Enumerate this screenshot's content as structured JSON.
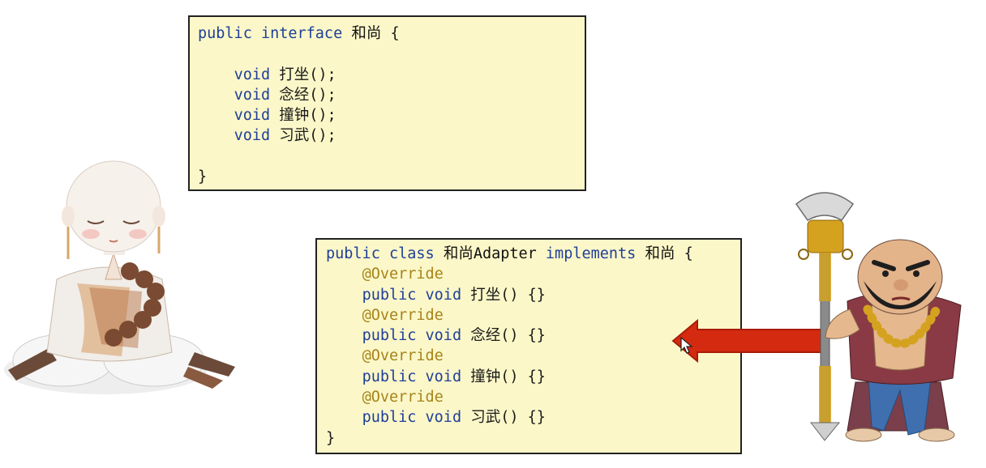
{
  "interface_code": {
    "header": {
      "kw_public": "public",
      "kw_interface": "interface",
      "name": "和尚",
      "brace": "{"
    },
    "methods": [
      {
        "kw": "void",
        "name": "打坐",
        "tail": "();"
      },
      {
        "kw": "void",
        "name": "念经",
        "tail": "();"
      },
      {
        "kw": "void",
        "name": "撞钟",
        "tail": "();"
      },
      {
        "kw": "void",
        "name": "习武",
        "tail": "();"
      }
    ],
    "close": "}"
  },
  "adapter_code": {
    "header": {
      "kw_public": "public",
      "kw_class": "class",
      "name": "和尚Adapter",
      "kw_implements": "implements",
      "iface": "和尚",
      "brace": "{"
    },
    "methods": [
      {
        "annotation": "@Override",
        "kw": "public void",
        "name": "打坐",
        "tail": "() {}"
      },
      {
        "annotation": "@Override",
        "kw": "public void",
        "name": "念经",
        "tail": "() {}"
      },
      {
        "annotation": "@Override",
        "kw": "public void",
        "name": "撞钟",
        "tail": "() {}"
      },
      {
        "annotation": "@Override",
        "kw": "public void",
        "name": "习武",
        "tail": "() {}"
      }
    ],
    "close": "}"
  },
  "colors": {
    "box_bg": "#fbf7c8",
    "keyword": "#1f3f99",
    "annotation": "#a6841a",
    "arrow": "#d42a10"
  },
  "illustrations": [
    "meditating-monk-illustration",
    "warrior-monk-illustration",
    "red-arrow-icon"
  ]
}
